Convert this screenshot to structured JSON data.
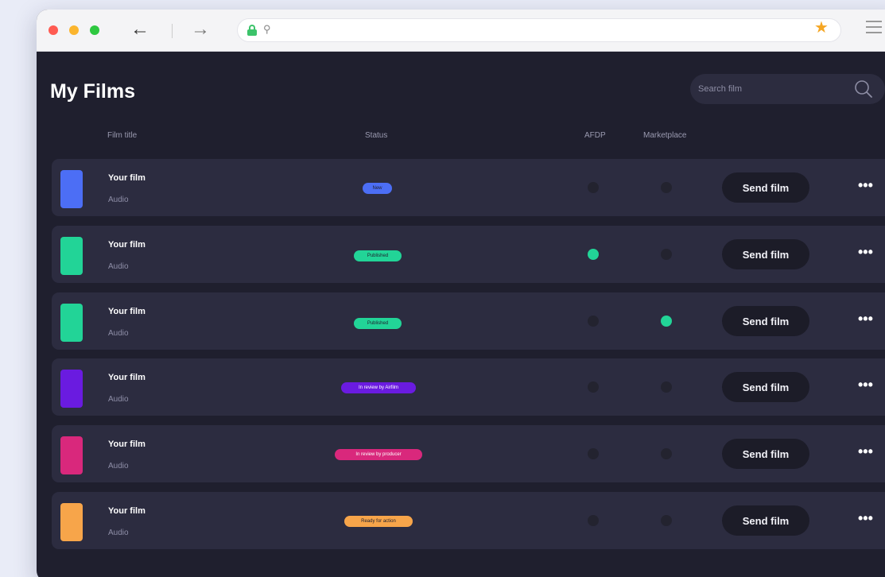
{
  "page": {
    "title": "My Films",
    "search": {
      "placeholder": "Search film"
    },
    "columns": {
      "film_title": "Film title",
      "status": "Status",
      "afdp": "AFDP",
      "marketplace": "Marketplace"
    }
  },
  "colors": {
    "background": "#1f1f2e",
    "row": "#2c2c40",
    "accent_green": "#22d497"
  },
  "films": [
    {
      "title": "Your film",
      "type": "Audio",
      "status": "New",
      "status_color": "#4c6ef5",
      "thumb_color": "#4c6ef5",
      "afdp": false,
      "marketplace": false,
      "send_label": "Send film",
      "more": "•••"
    },
    {
      "title": "Your film",
      "type": "Audio",
      "status": "Published",
      "status_color": "#22d497",
      "thumb_color": "#22d497",
      "afdp": true,
      "marketplace": false,
      "send_label": "Send film",
      "more": "•••"
    },
    {
      "title": "Your film",
      "type": "Audio",
      "status": "Published",
      "status_color": "#22d497",
      "thumb_color": "#22d497",
      "afdp": false,
      "marketplace": true,
      "send_label": "Send film",
      "more": "•••"
    },
    {
      "title": "Your film",
      "type": "Audio",
      "status": "In review by Airfilm",
      "status_color": "#6a1be0",
      "thumb_color": "#6a1be0",
      "afdp": false,
      "marketplace": false,
      "send_label": "Send film",
      "more": "•••"
    },
    {
      "title": "Your film",
      "type": "Audio",
      "status": "In review by producer",
      "status_color": "#d9287c",
      "thumb_color": "#d9287c",
      "afdp": false,
      "marketplace": false,
      "send_label": "Send film",
      "more": "•••"
    },
    {
      "title": "Your film",
      "type": "Audio",
      "status": "Ready for action",
      "status_color": "#f7a54a",
      "thumb_color": "#f7a54a",
      "afdp": false,
      "marketplace": false,
      "send_label": "Send film",
      "more": "•••"
    }
  ]
}
